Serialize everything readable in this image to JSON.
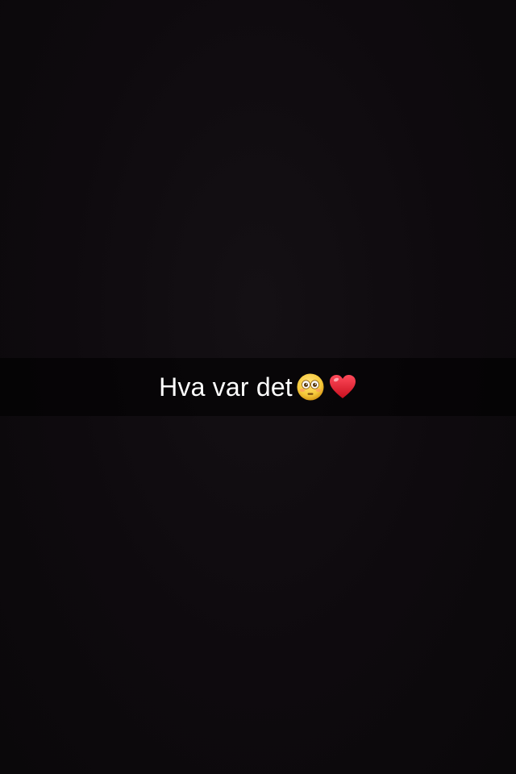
{
  "snap": {
    "caption_text": "Hva var det",
    "caption_emojis": [
      "flushed-face-icon",
      "red-heart-icon"
    ]
  },
  "colors": {
    "background": "#0d0a0d",
    "caption_bar": "#000000",
    "caption_text": "#ffffff",
    "heart": "#e5152b",
    "face": "#f6c93a"
  }
}
